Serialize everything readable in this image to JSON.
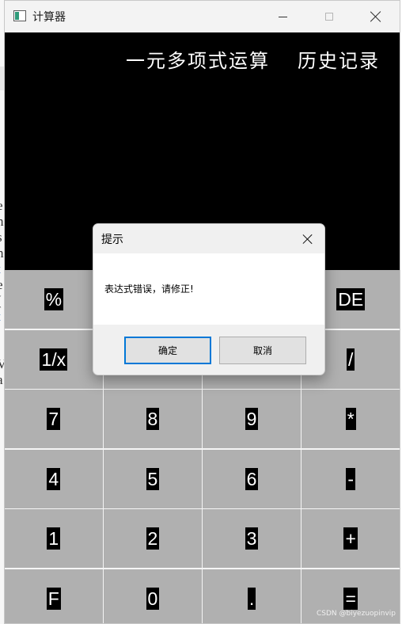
{
  "window": {
    "title": "计算器"
  },
  "display": {
    "mode_polynomial": "一元多项式运算",
    "mode_history": "历史记录"
  },
  "keypad": {
    "keys": [
      {
        "id": "percent",
        "label": "%"
      },
      {
        "id": "ce",
        "label": ""
      },
      {
        "id": "c",
        "label": ""
      },
      {
        "id": "del",
        "label": "DE"
      },
      {
        "id": "reciprocal",
        "label": "1/x"
      },
      {
        "id": "square",
        "label": ""
      },
      {
        "id": "sqrt",
        "label": ""
      },
      {
        "id": "divide",
        "label": "/"
      },
      {
        "id": "seven",
        "label": "7"
      },
      {
        "id": "eight",
        "label": "8"
      },
      {
        "id": "nine",
        "label": "9"
      },
      {
        "id": "multiply",
        "label": "*"
      },
      {
        "id": "four",
        "label": "4"
      },
      {
        "id": "five",
        "label": "5"
      },
      {
        "id": "six",
        "label": "6"
      },
      {
        "id": "subtract",
        "label": "-"
      },
      {
        "id": "one",
        "label": "1"
      },
      {
        "id": "two",
        "label": "2"
      },
      {
        "id": "three",
        "label": "3"
      },
      {
        "id": "add",
        "label": "+"
      },
      {
        "id": "f",
        "label": "F"
      },
      {
        "id": "zero",
        "label": "0"
      },
      {
        "id": "dot",
        "label": "."
      },
      {
        "id": "equals",
        "label": "="
      }
    ]
  },
  "dialog": {
    "title": "提示",
    "message": "表达式错误，请修正!",
    "ok_label": "确定",
    "cancel_label": "取消"
  },
  "watermark": "CSDN @biyezuopinvip",
  "colors": {
    "display_bg": "#000000",
    "key_bg": "#b0b0b0",
    "accent": "#0078d7"
  }
}
